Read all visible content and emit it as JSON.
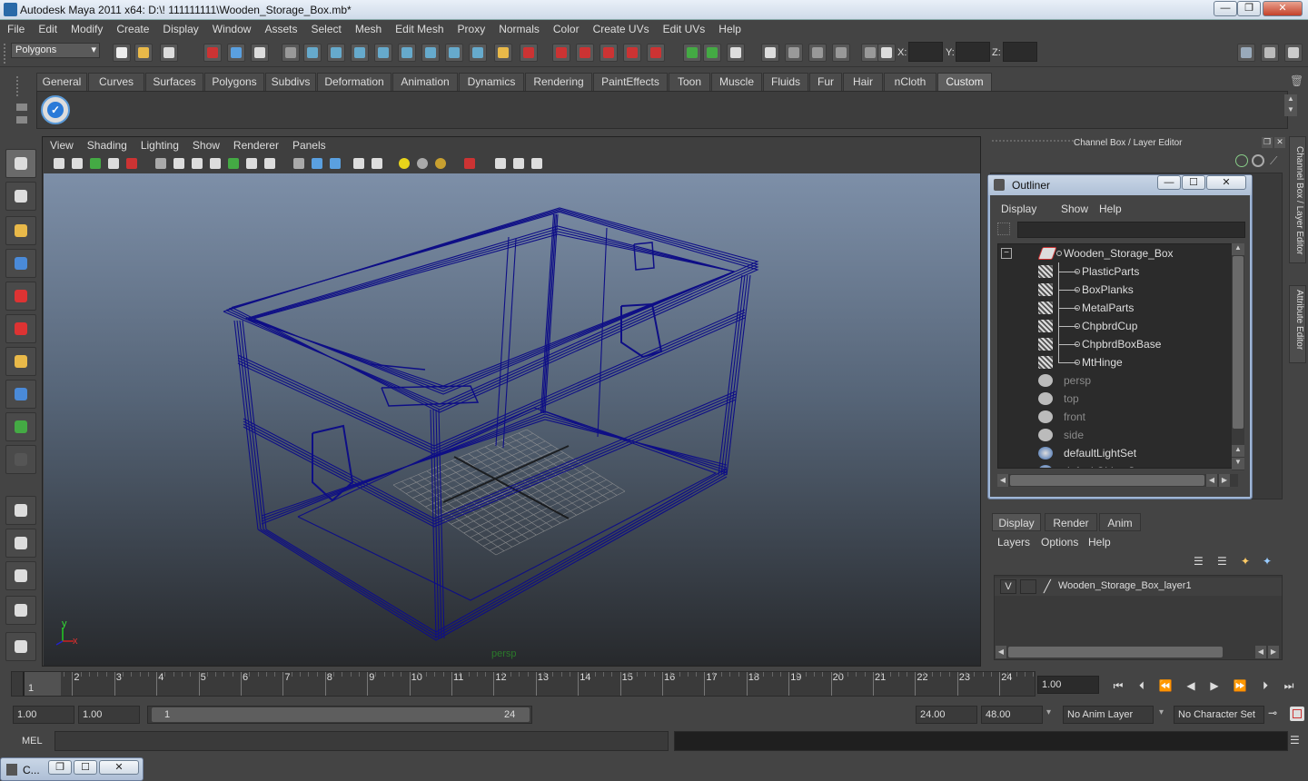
{
  "window": {
    "title": "Autodesk Maya 2011 x64: D:\\! 111111111\\Wooden_Storage_Box.mb*",
    "minimize": "—",
    "restore": "❐",
    "close": "✕"
  },
  "menubar": [
    "File",
    "Edit",
    "Modify",
    "Create",
    "Display",
    "Window",
    "Assets",
    "Select",
    "Mesh",
    "Edit Mesh",
    "Proxy",
    "Normals",
    "Color",
    "Create UVs",
    "Edit UVs",
    "Help"
  ],
  "status": {
    "mode": "Polygons",
    "x_label": "X:",
    "y_label": "Y:",
    "z_label": "Z:"
  },
  "shelf_tabs": [
    {
      "label": "General"
    },
    {
      "label": "Curves"
    },
    {
      "label": "Surfaces"
    },
    {
      "label": "Polygons"
    },
    {
      "label": "Subdivs"
    },
    {
      "label": "Deformation"
    },
    {
      "label": "Animation"
    },
    {
      "label": "Dynamics"
    },
    {
      "label": "Rendering"
    },
    {
      "label": "PaintEffects"
    },
    {
      "label": "Toon"
    },
    {
      "label": "Muscle"
    },
    {
      "label": "Fluids"
    },
    {
      "label": "Fur"
    },
    {
      "label": "Hair"
    },
    {
      "label": "nCloth"
    },
    {
      "label": "Custom",
      "active": true
    }
  ],
  "viewport": {
    "menu": [
      "View",
      "Shading",
      "Lighting",
      "Show",
      "Renderer",
      "Panels"
    ],
    "camera_label": "persp",
    "axis_x": "x",
    "axis_y": "y"
  },
  "channel_box": {
    "title": "Channel Box / Layer Editor",
    "side_tab_1": "Channel Box / Layer Editor",
    "side_tab_2": "Attribute Editor"
  },
  "outliner": {
    "title": "Outliner",
    "menu": [
      "Display",
      "Show",
      "Help"
    ],
    "expand": "−",
    "items": [
      {
        "label": "Wooden_Storage_Box",
        "type": "group",
        "indent": 0
      },
      {
        "label": "PlasticParts",
        "type": "mesh",
        "indent": 1
      },
      {
        "label": "BoxPlanks",
        "type": "mesh",
        "indent": 1
      },
      {
        "label": "MetalParts",
        "type": "mesh",
        "indent": 1
      },
      {
        "label": "ChpbrdCup",
        "type": "mesh",
        "indent": 1
      },
      {
        "label": "ChpbrdBoxBase",
        "type": "mesh",
        "indent": 1
      },
      {
        "label": "MtHinge",
        "type": "mesh",
        "indent": 1
      },
      {
        "label": "persp",
        "type": "camera",
        "indent": 0,
        "dim": true
      },
      {
        "label": "top",
        "type": "camera",
        "indent": 0,
        "dim": true
      },
      {
        "label": "front",
        "type": "camera",
        "indent": 0,
        "dim": true
      },
      {
        "label": "side",
        "type": "camera",
        "indent": 0,
        "dim": true
      },
      {
        "label": "defaultLightSet",
        "type": "set",
        "indent": 0
      },
      {
        "label": "defaultObjectSet",
        "type": "set",
        "indent": 0
      }
    ]
  },
  "layer_editor": {
    "tabs": [
      "Display",
      "Render",
      "Anim"
    ],
    "menu": [
      "Layers",
      "Options",
      "Help"
    ],
    "layer": {
      "visible": "V",
      "name": "Wooden_Storage_Box_layer1"
    }
  },
  "timeline": {
    "ticks": [
      "1",
      "2",
      "3",
      "4",
      "5",
      "6",
      "7",
      "8",
      "9",
      "10",
      "11",
      "12",
      "13",
      "14",
      "15",
      "16",
      "17",
      "18",
      "19",
      "20",
      "21",
      "22",
      "23",
      "24"
    ],
    "current_marker": "1",
    "current_time": "1.00"
  },
  "range": {
    "start_time": "1.00",
    "playback_start": "1.00",
    "slider_start": "1",
    "slider_end": "24",
    "playback_end": "24.00",
    "end_time": "48.00",
    "anim_layer": "No Anim Layer",
    "character_set": "No Character Set"
  },
  "mel": {
    "label": "MEL"
  },
  "taskbar": {
    "label": "C..."
  },
  "colors": {
    "wireframe": "#0e0e86",
    "bg_top": "#7d8fa8",
    "bg_bottom": "#27292c",
    "panel": "#444444"
  }
}
